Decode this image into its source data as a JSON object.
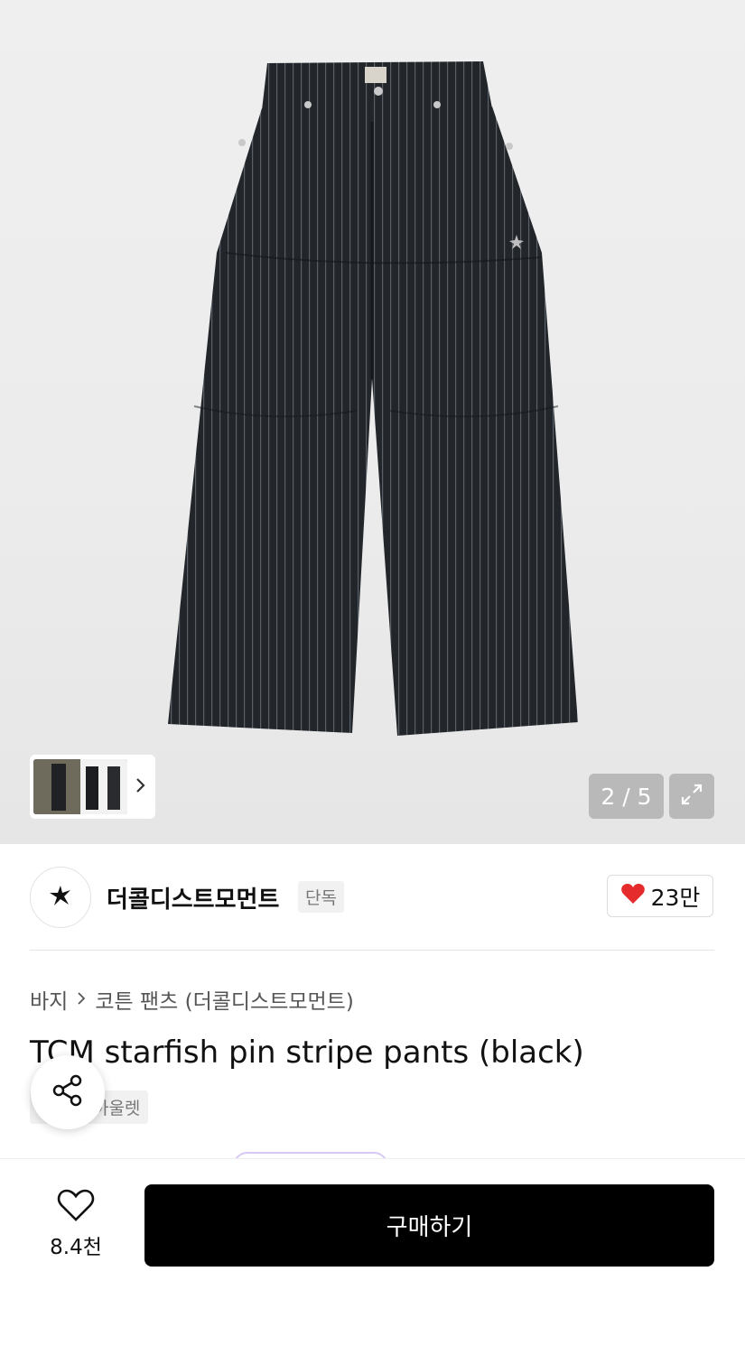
{
  "gallery": {
    "counter": "2 / 5",
    "thumbnail_next_icon": "chevron-right-icon",
    "expand_icon": "expand-icon"
  },
  "brand": {
    "name": "더콜디스트모먼트",
    "exclusive_tag": "단독",
    "logo_icon": "starfish-icon",
    "like_count": "23만",
    "like_color": "#e52b2b"
  },
  "breadcrumb": {
    "category": "바지",
    "subcategory": "코튼 팬츠 (더콜디스트모먼트)"
  },
  "product": {
    "title": "TCM starfish pin stripe pants (black)",
    "tags": [
      "단독",
      "아울렛"
    ]
  },
  "bottom": {
    "wish_count": "8.4천",
    "buy_label": "구매하기"
  }
}
